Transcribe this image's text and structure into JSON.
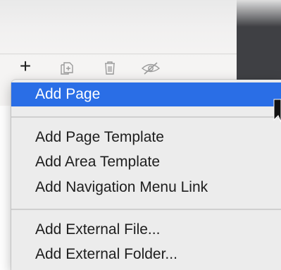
{
  "toolbar": {
    "add_icon": "plus-icon",
    "duplicate_icon": "duplicate-icon",
    "trash_icon": "trash-icon",
    "hide_icon": "eye-slash-icon",
    "add_glyph": "+"
  },
  "menu": {
    "items": [
      {
        "label": "Add Page",
        "selected": true
      },
      {
        "label": "Add Page Template"
      },
      {
        "label": "Add Area Template"
      },
      {
        "label": "Add Navigation Menu Link"
      },
      {
        "label": "Add External File..."
      },
      {
        "label": "Add External Folder..."
      }
    ]
  },
  "colors": {
    "selection": "#2a6ee6",
    "menu_bg": "#ececec",
    "dark_panel": "#3f4044"
  }
}
